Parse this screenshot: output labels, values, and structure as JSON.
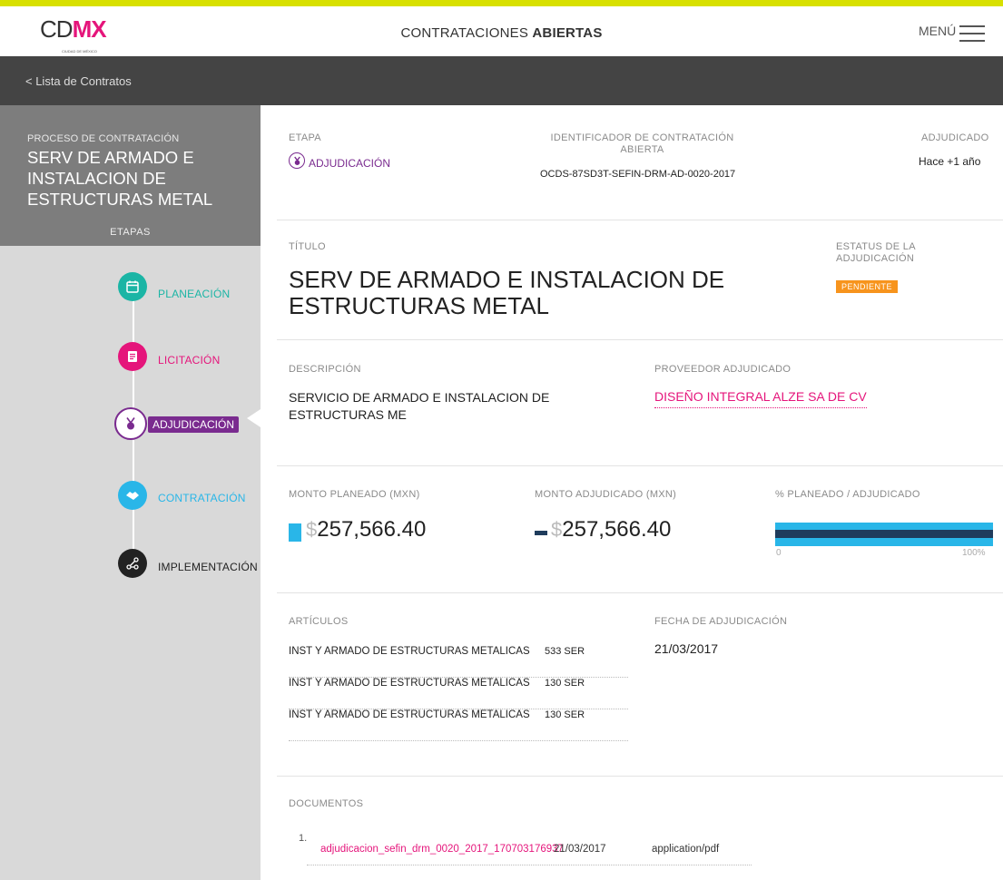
{
  "header": {
    "logo_prefix": "CD",
    "logo_accent": "MX",
    "logo_subtitle": "CIUDAD DE MÉXICO",
    "title_light": "CONTRATACIONES ",
    "title_bold": "ABIERTAS",
    "menu_label": "MENÚ"
  },
  "nav": {
    "back_link": "< Lista de Contratos"
  },
  "sidebar": {
    "process_label": "PROCESO DE CONTRATACIÓN",
    "process_title": "SERV DE ARMADO E INSTALACION DE ESTRUCTURAS METAL",
    "stages_label": "ETAPAS",
    "stages": [
      {
        "label": "PLANEACIÓN",
        "icon": "calendar-icon",
        "color": "#1bb5a5"
      },
      {
        "label": "LICITACIÓN",
        "icon": "document-icon",
        "color": "#e5157b"
      },
      {
        "label": "ADJUDICACIÓN",
        "icon": "medal-icon",
        "color": "#7a2b8f"
      },
      {
        "label": "CONTRATACIÓN",
        "icon": "handshake-icon",
        "color": "#29b6e8"
      },
      {
        "label": "IMPLEMENTACIÓN",
        "icon": "network-icon",
        "color": "#222222"
      }
    ]
  },
  "summary": {
    "etapa_label": "ETAPA",
    "etapa_value": "ADJUDICACIÓN",
    "ocid_label": "IDENTIFICADOR DE CONTRATACIÓN ABIERTA",
    "ocid_value": "OCDS-87SD3T-SEFIN-DRM-AD-0020-2017",
    "adjudicado_label": "ADJUDICADO",
    "adjudicado_value": "Hace +1 año"
  },
  "title_section": {
    "label": "TÍTULO",
    "value": "SERV DE ARMADO E INSTALACION DE ESTRUCTURAS METAL",
    "status_label": "ESTATUS DE LA ADJUDICACIÓN",
    "status_value": "PENDIENTE"
  },
  "description_section": {
    "label": "DESCRIPCIÓN",
    "value": "SERVICIO DE ARMADO E INSTALACION DE ESTRUCTURAS ME",
    "supplier_label": "PROVEEDOR ADJUDICADO",
    "supplier_value": "DISEÑO INTEGRAL ALZE SA DE CV"
  },
  "amounts": {
    "planned_label": "MONTO PLANEADO (MXN)",
    "planned_currency": "$",
    "planned_value": "257,566.40",
    "awarded_label": "MONTO ADJUDICADO (MXN)",
    "awarded_currency": "$",
    "awarded_value": "257,566.40",
    "ratio_label": "% PLANEADO / ADJUDICADO",
    "ratio_axis_min": "0",
    "ratio_axis_max": "100%",
    "planned_fraction": 1.0,
    "awarded_fraction": 1.0,
    "planned_color": "#29b6e8",
    "awarded_color": "#1f3c5c"
  },
  "articles": {
    "label": "ARTÍCULOS",
    "items": [
      {
        "name": "INST Y ARMADO DE ESTRUCTURAS METALICAS",
        "qty": "533 SER"
      },
      {
        "name": "INST Y ARMADO DE ESTRUCTURAS METALICAS",
        "qty": "130 SER"
      },
      {
        "name": "INST Y ARMADO DE ESTRUCTURAS METALICAS",
        "qty": "130 SER"
      }
    ],
    "date_label": "FECHA DE ADJUDICACIÓN",
    "date_value": "21/03/2017"
  },
  "documents": {
    "label": "DOCUMENTOS",
    "items": [
      {
        "num": "1.",
        "name": "adjudicacion_sefin_drm_0020_2017_170703176937",
        "date": "21/03/2017",
        "type": "application/pdf"
      }
    ]
  }
}
